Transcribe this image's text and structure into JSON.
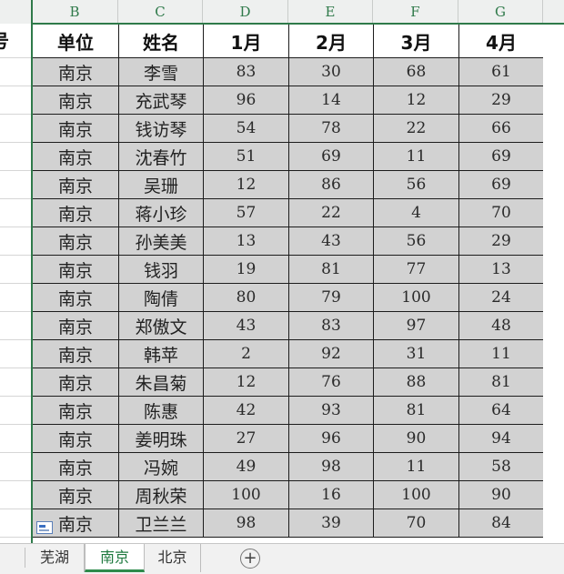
{
  "column_letters": [
    "B",
    "C",
    "D",
    "E",
    "F",
    "G"
  ],
  "partial_left_header": "号",
  "table": {
    "headers": [
      "单位",
      "姓名",
      "1月",
      "2月",
      "3月",
      "4月"
    ],
    "rows": [
      [
        "南京",
        "李雪",
        "83",
        "30",
        "68",
        "61"
      ],
      [
        "南京",
        "充武琴",
        "96",
        "14",
        "12",
        "29"
      ],
      [
        "南京",
        "钱访琴",
        "54",
        "78",
        "22",
        "66"
      ],
      [
        "南京",
        "沈春竹",
        "51",
        "69",
        "11",
        "69"
      ],
      [
        "南京",
        "吴珊",
        "12",
        "86",
        "56",
        "69"
      ],
      [
        "南京",
        "蒋小珍",
        "57",
        "22",
        "4",
        "70"
      ],
      [
        "南京",
        "孙美美",
        "13",
        "43",
        "56",
        "29"
      ],
      [
        "南京",
        "钱羽",
        "19",
        "81",
        "77",
        "13"
      ],
      [
        "南京",
        "陶倩",
        "80",
        "79",
        "100",
        "24"
      ],
      [
        "南京",
        "郑傲文",
        "43",
        "83",
        "97",
        "48"
      ],
      [
        "南京",
        "韩苹",
        "2",
        "92",
        "31",
        "11"
      ],
      [
        "南京",
        "朱昌菊",
        "12",
        "76",
        "88",
        "81"
      ],
      [
        "南京",
        "陈惠",
        "42",
        "93",
        "81",
        "64"
      ],
      [
        "南京",
        "姜明珠",
        "27",
        "96",
        "90",
        "94"
      ],
      [
        "南京",
        "冯婉",
        "49",
        "98",
        "11",
        "58"
      ],
      [
        "南京",
        "周秋荣",
        "100",
        "16",
        "100",
        "90"
      ],
      [
        "南京",
        "卫兰兰",
        "98",
        "39",
        "70",
        "84"
      ]
    ]
  },
  "sheet_tabs": [
    {
      "label": "芜湖",
      "active": false
    },
    {
      "label": "南京",
      "active": true
    },
    {
      "label": "北京",
      "active": false
    }
  ],
  "add_sheet_symbol": "+",
  "icons": {
    "quick_analysis": "quick-analysis-icon",
    "add_sheet": "plus-circle-icon"
  },
  "colors": {
    "accent_green": "#2e8b4b",
    "data_cell_bg": "#d2d2d2",
    "header_cell_bg": "#ffffff"
  }
}
